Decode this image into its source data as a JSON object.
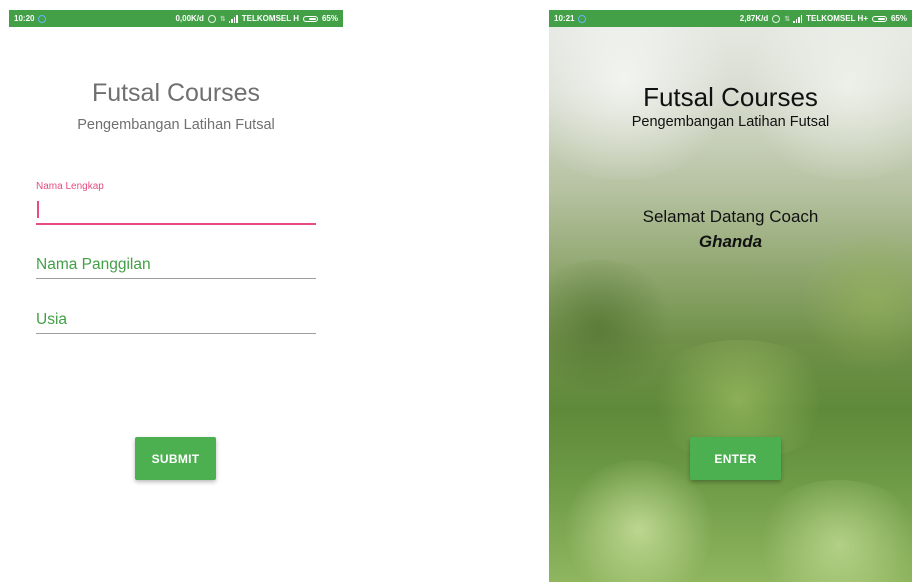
{
  "left_screen": {
    "status_bar": {
      "time": "10:20",
      "net_speed": "0,00K/d",
      "carrier": "TELKOMSEL H",
      "battery": "65%"
    },
    "title": "Futsal Courses",
    "subtitle": "Pengembangan Latihan Futsal",
    "form": {
      "full_name": {
        "label": "Nama Lengkap",
        "value": ""
      },
      "nickname": {
        "placeholder": "Nama Panggilan"
      },
      "age": {
        "placeholder": "Usia"
      }
    },
    "submit_label": "SUBMIT"
  },
  "right_screen": {
    "status_bar": {
      "time": "10:21",
      "net_speed": "2,87K/d",
      "carrier": "TELKOMSEL H+",
      "battery": "65%"
    },
    "title": "Futsal Courses",
    "subtitle": "Pengembangan Latihan Futsal",
    "greeting": "Selamat Datang Coach",
    "coach_name": "Ghanda",
    "enter_label": "ENTER"
  },
  "colors": {
    "accent_green": "#4caf50",
    "status_bar_green": "#43a047",
    "focus_pink": "#e94b7f",
    "title_gray": "#707070"
  },
  "icons": [
    "sync-icon",
    "alarm-icon",
    "data-arrows-icon",
    "signal-icon",
    "battery-icon"
  ]
}
